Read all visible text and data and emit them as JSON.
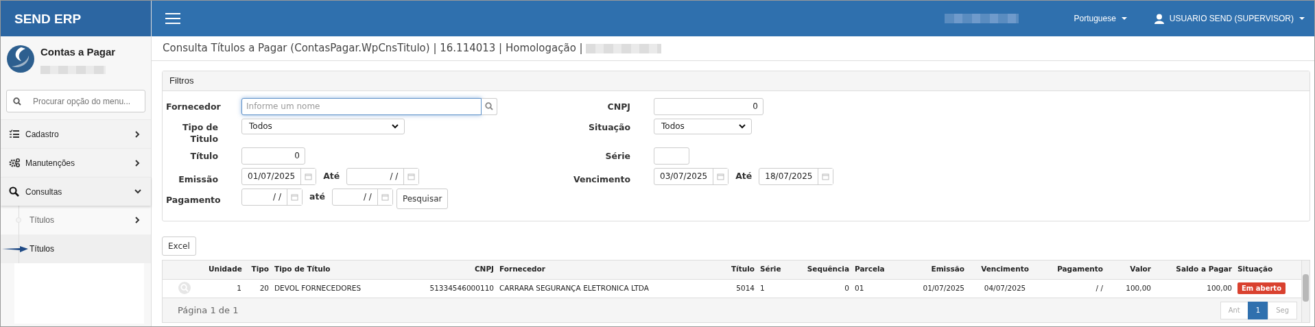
{
  "app": {
    "brand": "SEND ERP"
  },
  "topbar": {
    "language": "Portuguese",
    "user": "USUARIO SEND (SUPERVISOR)"
  },
  "sidebar": {
    "module": "Contas a Pagar",
    "search": {
      "placeholder": "Procurar opção do menu..."
    },
    "items": [
      {
        "label": "Cadastro",
        "kind": "list",
        "expanded": false
      },
      {
        "label": "Manutenções",
        "kind": "gears",
        "expanded": false
      },
      {
        "label": "Consultas",
        "kind": "search",
        "expanded": true,
        "children": [
          {
            "label": "Títulos",
            "has_children": true,
            "selected": false
          },
          {
            "label": "Títulos",
            "has_children": false,
            "selected": true
          }
        ]
      }
    ]
  },
  "page_title": "Consulta Títulos a Pagar (ContasPagar.WpCnsTitulo) | 16.114013 | Homologação |",
  "filters": {
    "title": "Filtros",
    "left": [
      {
        "kind": "search",
        "label": "Fornecedor",
        "placeholder": "Informe um nome",
        "focused": true
      },
      {
        "kind": "select",
        "label": "Tipo de Titulo",
        "value": "Todos"
      },
      {
        "kind": "number",
        "label": "Título",
        "value": "0"
      },
      {
        "kind": "daterange",
        "label": "Emissão",
        "from": "01/07/2025",
        "to_label": "Até",
        "to": "/ /"
      },
      {
        "kind": "daterange",
        "label": "Pagamento",
        "from": "/ /",
        "to_label": "até",
        "to": "/ /",
        "button": "Pesquisar"
      }
    ],
    "right": [
      {
        "kind": "number",
        "label": "CNPJ",
        "value": "0"
      },
      {
        "kind": "select",
        "label": "Situação",
        "value": "Todos"
      },
      {
        "kind": "number",
        "label": "Série"
      },
      {
        "kind": "daterange",
        "label": "Vencimento",
        "from": "03/07/2025",
        "to_label": "Até",
        "to": "18/07/2025"
      }
    ]
  },
  "results": {
    "excel_button": "Excel",
    "columns": [
      "Unidade",
      "Tipo",
      "Tipo de Título",
      "CNPJ",
      "Fornecedor",
      "Título",
      "Série",
      "Sequência",
      "Parcela",
      "Emissão",
      "Vencimento",
      "Pagamento",
      "Valor",
      "Saldo a Pagar",
      "Situação"
    ],
    "rows": [
      {
        "cells": [
          "1",
          "20",
          "DEVOL FORNECEDORES",
          "51334546000110",
          "CARRARA SEGURANÇA ELETRONICA LTDA",
          "5014",
          "1",
          "0",
          "01",
          "01/07/2025",
          "04/07/2025",
          "/ /",
          "100,00",
          "100,00"
        ],
        "status": {
          "label": "Em aberto",
          "color": "#d9412f"
        }
      }
    ],
    "footer": {
      "page_info": "Página 1 de 1",
      "pagination": [
        {
          "label": "Ant",
          "selected": false,
          "disabled": true
        },
        {
          "label": "1",
          "selected": true,
          "disabled": false
        },
        {
          "label": "Seg",
          "selected": false,
          "disabled": true
        }
      ]
    }
  }
}
